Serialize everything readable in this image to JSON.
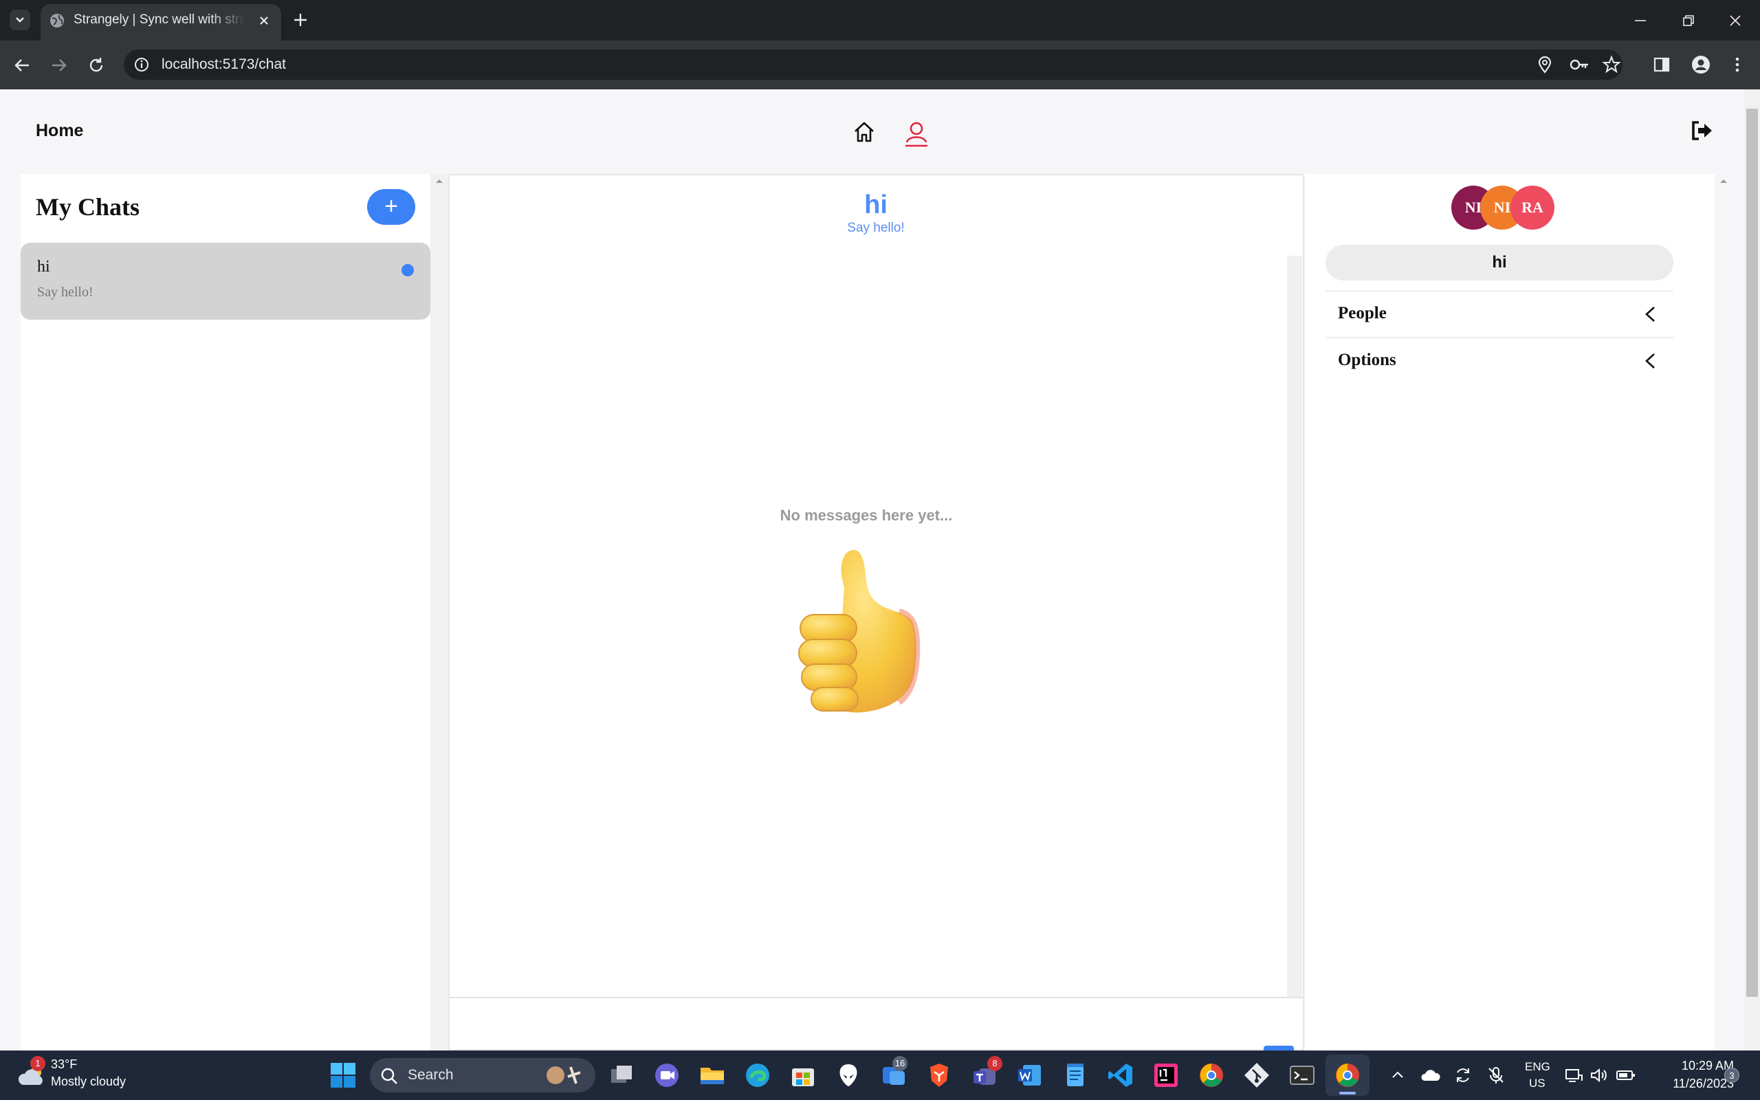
{
  "browser": {
    "tab_title": "Strangely | Sync well with strangers",
    "url": "localhost:5173/chat"
  },
  "nav": {
    "home_label": "Home"
  },
  "chats": {
    "title": "My Chats",
    "new_chat_label": "+",
    "items": [
      {
        "name": "hi",
        "preview": "Say hello!",
        "unread": true
      }
    ]
  },
  "conversation": {
    "title": "hi",
    "subtitle": "Say hello!",
    "empty_text": "No messages here yet..."
  },
  "details": {
    "avatars": [
      {
        "initials": "NI",
        "color": "#8b1a4f"
      },
      {
        "initials": "NI",
        "color": "#f07c2a"
      },
      {
        "initials": "RA",
        "color": "#ef4b5f"
      }
    ],
    "group_name": "hi",
    "sections": [
      {
        "label": "People"
      },
      {
        "label": "Options"
      }
    ]
  },
  "taskbar": {
    "weather": {
      "temp": "33°F",
      "desc": "Mostly cloudy",
      "badge": "1"
    },
    "search_label": "Search",
    "badges": {
      "teams_chat": "16",
      "teams": "8",
      "notifications": "3"
    },
    "language": {
      "line1": "ENG",
      "line2": "US"
    },
    "clock": {
      "time": "10:29 AM",
      "date": "11/26/2023"
    }
  },
  "colors": {
    "accent": "#3b82f6",
    "title_blue": "#4f8ef7",
    "active_nav": "#e0263d",
    "taskbar_bg": "#1f2838"
  }
}
